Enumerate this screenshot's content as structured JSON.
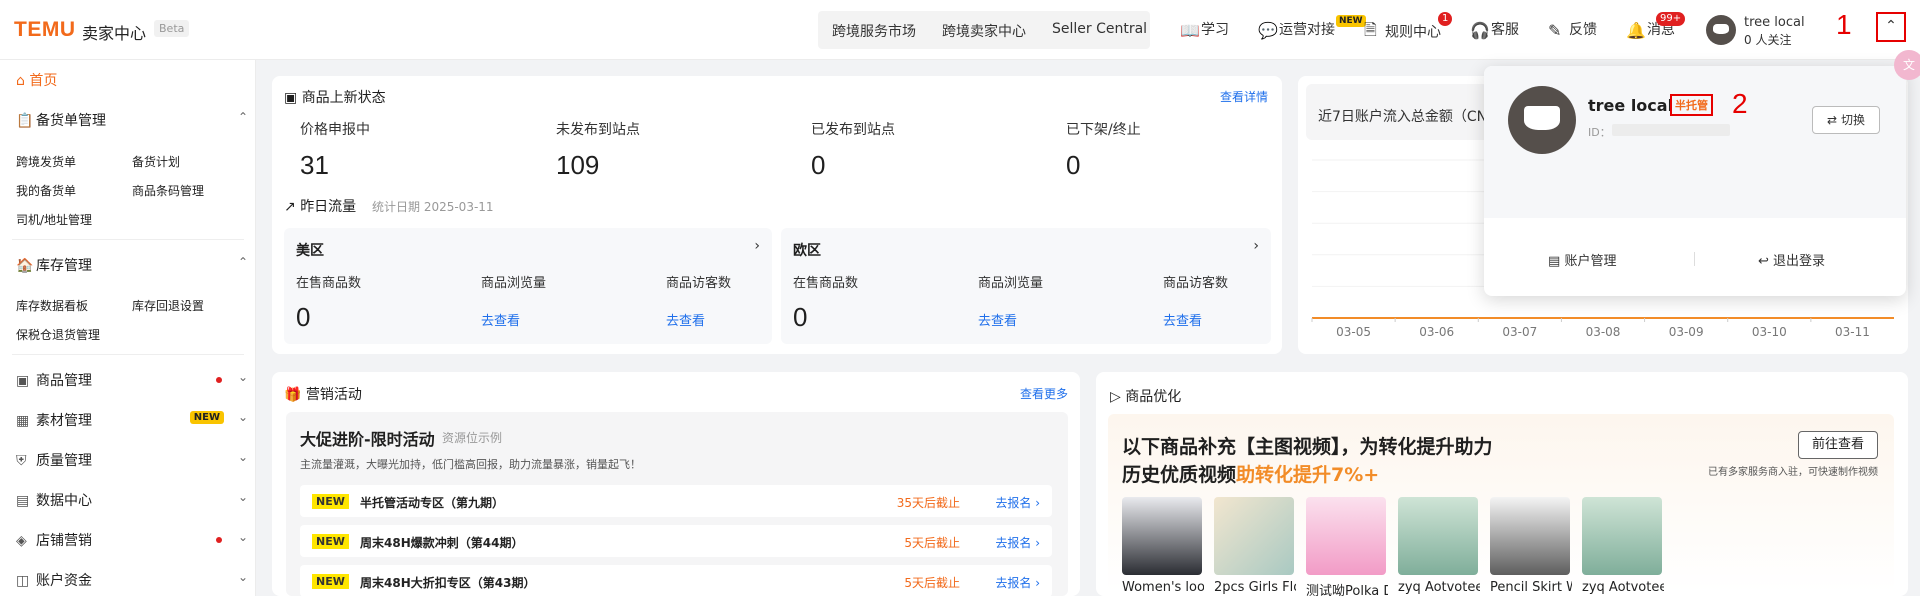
{
  "brand": {
    "logo": "TEMU",
    "subtitle": "卖家中心",
    "beta": "Beta"
  },
  "header": {
    "links": [
      "跨境服务市场",
      "跨境卖家中心",
      "Seller Central"
    ],
    "tools": {
      "learn": "学习",
      "ops": "运营对接",
      "ops_badge": "NEW",
      "rules": "规则中心",
      "rules_badge": "1",
      "service": "客服",
      "feedback": "反馈",
      "messages": "消息",
      "messages_badge": "99+"
    },
    "user": {
      "name": "tree local",
      "followers": "0 人关注"
    },
    "annotation_1": "1"
  },
  "sidebar": {
    "home": "首页",
    "sections": [
      {
        "label": "备货单管理",
        "items": [
          "跨境发货单",
          "备货计划",
          "我的备货单",
          "商品条码管理",
          "司机/地址管理"
        ]
      },
      {
        "label": "库存管理",
        "items": [
          "库存数据看板",
          "库存回退设置",
          "保税仓退货管理"
        ]
      },
      {
        "label": "商品管理"
      },
      {
        "label": "素材管理",
        "badge": "NEW"
      },
      {
        "label": "质量管理"
      },
      {
        "label": "数据中心"
      },
      {
        "label": "店铺营销"
      },
      {
        "label": "账户资金"
      }
    ]
  },
  "listing": {
    "title": "商品上新状态",
    "link": "查看详情",
    "stats": [
      {
        "label": "价格申报中",
        "value": "31"
      },
      {
        "label": "未发布到站点",
        "value": "109"
      },
      {
        "label": "已发布到站点",
        "value": "0"
      },
      {
        "label": "已下架/终止",
        "value": "0"
      }
    ],
    "traffic_title": "昨日流量",
    "traffic_date": "统计日期 2025-03-11",
    "regions": [
      {
        "name": "美区",
        "col1": "在售商品数",
        "col2": "商品浏览量",
        "col3": "商品访客数",
        "value": "0",
        "go": "去查看"
      },
      {
        "name": "欧区",
        "col1": "在售商品数",
        "col2": "商品浏览量",
        "col3": "商品访客数",
        "value": "0",
        "go": "去查看"
      }
    ]
  },
  "inflow": {
    "title": "近7日账户流入总金额（CN",
    "chart_data": {
      "type": "line",
      "title": "",
      "categories": [
        "03-05",
        "03-06",
        "03-07",
        "03-08",
        "03-09",
        "03-10",
        "03-11"
      ],
      "series": [
        {
          "values": [
            0,
            0,
            0,
            0,
            0,
            0,
            0
          ]
        }
      ],
      "colors": {
        "line": "#f28c28"
      }
    }
  },
  "popover": {
    "name": "tree local",
    "tag": "半托管",
    "id_label": "ID：",
    "switch": "切换",
    "account": "账户管理",
    "logout": "退出登录",
    "annotation_2": "2"
  },
  "marketing": {
    "title": "营销活动",
    "more": "查看更多",
    "promo_title": "大促进阶-限时活动",
    "promo_tag": "资源位示例",
    "promo_desc": "主流量灌溉，大曝光加持，低门槛高回报，助力流量暴涨，销量起飞！",
    "rows": [
      {
        "badge": "NEW",
        "title": "半托管活动专区（第九期）",
        "deadline": "35天后截止",
        "link": "去报名"
      },
      {
        "badge": "NEW",
        "title": "周末48H爆款冲刺（第44期）",
        "deadline": "5天后截止",
        "link": "去报名"
      },
      {
        "badge": "NEW",
        "title": "周末48H大折扣专区（第43期）",
        "deadline": "5天后截止",
        "link": "去报名"
      }
    ]
  },
  "optimize": {
    "title": "商品优化",
    "headline1": "以下商品补充【主图视频】，为转化提升助力",
    "headline2_prefix": "历史优质视频",
    "headline2_highlight": "助转化提升7%+",
    "button": "前往查看",
    "note": "已有多家服务商入驻，可快速制作视频",
    "products": [
      {
        "name": "Women's loo",
        "icon": "tshirt-photo"
      },
      {
        "name": "2pcs Girls Flo",
        "icon": "bucket-hat-photo"
      },
      {
        "name": "测试呦Polka D",
        "icon": "swimsuit-photo"
      },
      {
        "name": "zyq Aotvotee",
        "icon": "dress-photo"
      },
      {
        "name": "Pencil Skirt W",
        "icon": "skirt-photo"
      },
      {
        "name": "zyq Aotvotee",
        "icon": "dress-photo"
      }
    ]
  },
  "colors": {
    "accent": "#f26a1b",
    "link": "#1f6feb",
    "annotation": "#e60000"
  }
}
